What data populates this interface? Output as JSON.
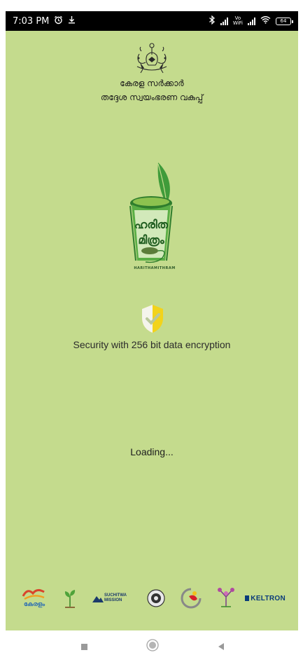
{
  "status_bar": {
    "time": "7:03 PM",
    "alarm_icon": "alarm-icon",
    "download_icon": "download-icon",
    "bluetooth_icon": "bluetooth-icon",
    "vowifi_top": "Vo",
    "vowifi_bottom": "WiFi",
    "wifi_icon": "wifi-icon",
    "battery_level": "64"
  },
  "header": {
    "emblem_icon": "kerala-emblem-icon",
    "line1": "കേരള സർക്കാർ",
    "line2": "തദ്ദേശ സ്വയംഭരണ വകുപ്പ്"
  },
  "logo": {
    "icon": "harithamithram-logo-icon",
    "text_line1": "ഹരിത",
    "text_line2": "മിത്രം",
    "caption": "HARITHAMITHRAM"
  },
  "security": {
    "icon": "shield-check-icon",
    "text": "Security with 256 bit data encryption"
  },
  "loading": {
    "text": "Loading..."
  },
  "partners": [
    {
      "name": "kerala-mission-logo",
      "text": "കേരളം"
    },
    {
      "name": "plant-logo",
      "text": ""
    },
    {
      "name": "suchitwa-mission-logo",
      "text_line1": "SUCHITWA",
      "text_line2": "MISSION"
    },
    {
      "name": "seal-logo",
      "text": ""
    },
    {
      "name": "ksitm-logo",
      "text": ""
    },
    {
      "name": "kudumbashree-logo",
      "text": ""
    },
    {
      "name": "keltron-logo",
      "text": "KELTRON"
    }
  ],
  "colors": {
    "screen_background": "#c4db8d",
    "leaf_green": "#4a9a3c",
    "shield_yellow": "#f2d31b",
    "status_bar": "#000000"
  },
  "nav_bar": {
    "recents_icon": "square-icon",
    "home_icon": "circle-icon",
    "back_icon": "triangle-back-icon"
  }
}
